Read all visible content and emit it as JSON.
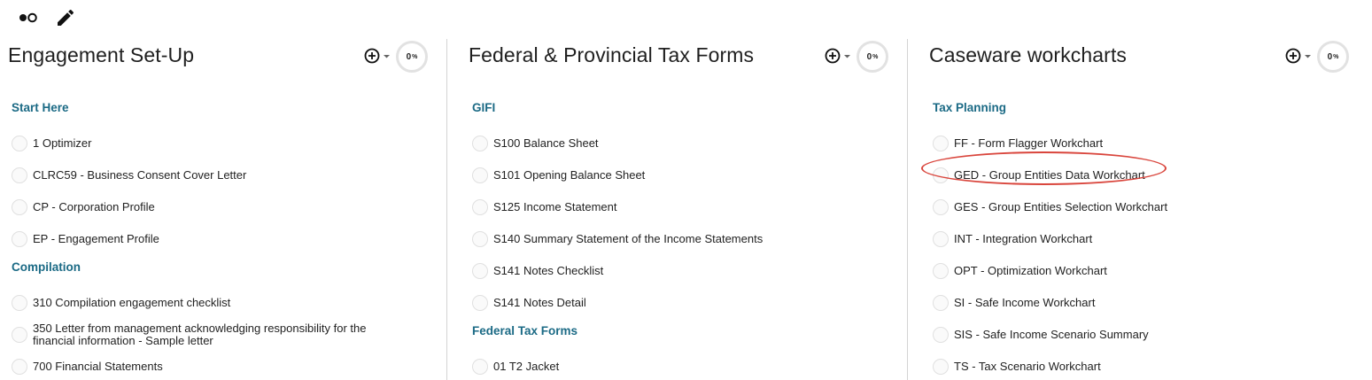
{
  "toolbar": {
    "view_toggle_icon": "dots-toggle-icon",
    "edit_icon": "pencil-icon"
  },
  "columns": [
    {
      "title": "Engagement Set-Up",
      "progress_value": "0",
      "progress_unit": "%",
      "sections": [
        {
          "label": "Start Here",
          "items": [
            "1 Optimizer",
            "CLRC59 - Business Consent Cover Letter",
            "CP - Corporation Profile",
            "EP - Engagement Profile"
          ]
        },
        {
          "label": "Compilation",
          "items": [
            "310 Compilation engagement checklist",
            "350 Letter from management acknowledging responsibility for the financial information - Sample letter",
            "700 Financial Statements"
          ]
        }
      ]
    },
    {
      "title": "Federal & Provincial Tax Forms",
      "progress_value": "0",
      "progress_unit": "%",
      "sections": [
        {
          "label": "GIFI",
          "items": [
            "S100 Balance Sheet",
            "S101 Opening Balance Sheet",
            "S125 Income Statement",
            "S140 Summary Statement of the Income Statements",
            "S141 Notes Checklist",
            "S141 Notes Detail"
          ]
        },
        {
          "label": "Federal Tax Forms",
          "items": [
            "01 T2 Jacket"
          ]
        }
      ]
    },
    {
      "title": "Caseware workcharts",
      "progress_value": "0",
      "progress_unit": "%",
      "sections": [
        {
          "label": "Tax Planning",
          "items": [
            "FF - Form Flagger Workchart",
            "GED - Group Entities Data Workchart",
            "GES - Group Entities Selection Workchart",
            "INT - Integration Workchart",
            "OPT - Optimization Workchart",
            "SI - Safe Income Workchart",
            "SIS - Safe Income Scenario Summary",
            "TS - Tax Scenario Workchart"
          ]
        }
      ]
    }
  ],
  "colors": {
    "section_label": "#1b6a85",
    "highlight_annotation": "#d9453c"
  }
}
